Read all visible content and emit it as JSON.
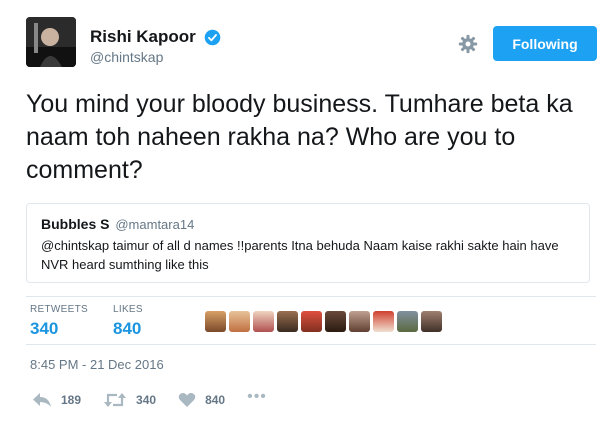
{
  "author": {
    "display_name": "Rishi Kapoor",
    "handle": "@chintskap",
    "verified": true
  },
  "header": {
    "settings_icon": "gear-icon",
    "follow_label": "Following"
  },
  "tweet": {
    "text": "You mind your bloody business. Tumhare beta ka naam toh naheen rakha na? Who are you to comment?"
  },
  "quoted_tweet": {
    "name": "Bubbles S",
    "handle": "@mamtara14",
    "text": "@chintskap taimur of all d names !!parents  Itna behuda Naam kaise rakhi sakte hain have NVR heard sumthing like this"
  },
  "stats": {
    "retweets_label": "RETWEETS",
    "retweets_count": "340",
    "likes_label": "LIKES",
    "likes_count": "840"
  },
  "timestamp": "8:45 PM - 21 Dec 2016",
  "actions": {
    "reply_count": "189",
    "retweet_count": "340",
    "like_count": "840",
    "more_label": "•••"
  },
  "colors": {
    "accent": "#1da1f2",
    "link": "#1b95e0",
    "muted": "#657786",
    "border": "#e1e8ed"
  }
}
